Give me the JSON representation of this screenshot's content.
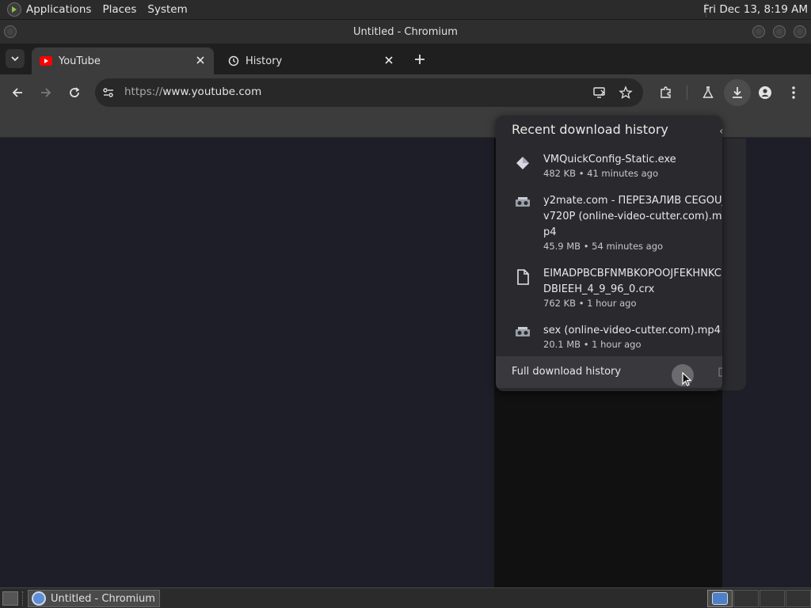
{
  "top_panel": {
    "menus": [
      "Applications",
      "Places",
      "System"
    ],
    "clock": "Fri Dec 13,  8:19 AM"
  },
  "window": {
    "title": "Untitled - Chromium"
  },
  "tabs": [
    {
      "label": "YouTube",
      "icon": "youtube-icon",
      "active": true
    },
    {
      "label": "History",
      "icon": "history-icon",
      "active": false
    }
  ],
  "toolbar": {
    "url_scheme": "https://",
    "url_host": "www.youtube.com"
  },
  "downloads": {
    "heading": "Recent download history",
    "items": [
      {
        "name": "VMQuickConfig-Static.exe",
        "meta": "482 KB • 41 minutes ago",
        "icon": "exe-icon"
      },
      {
        "name": "y2mate.com - ПЕРЕЗАЛИВ CEGOU_v720P (online-video-cutter.com).mp4",
        "meta": "45.9 MB • 54 minutes ago",
        "icon": "video-file-icon"
      },
      {
        "name": "EIMADPBCBFNMBKOPOOJFEKHNKCDBIEEH_4_9_96_0.crx",
        "meta": "762 KB • 1 hour ago",
        "icon": "file-icon"
      },
      {
        "name": "sex (online-video-cutter.com).mp4",
        "meta": "20.1 MB • 1 hour ago",
        "icon": "video-file-icon"
      }
    ],
    "footer_label": "Full download history"
  },
  "taskbar": {
    "task_label": "Untitled - Chromium"
  },
  "colors": {
    "accent_youtube": "#ff0000",
    "background": "#1e1e29",
    "bubble": "#2a2a2e"
  }
}
